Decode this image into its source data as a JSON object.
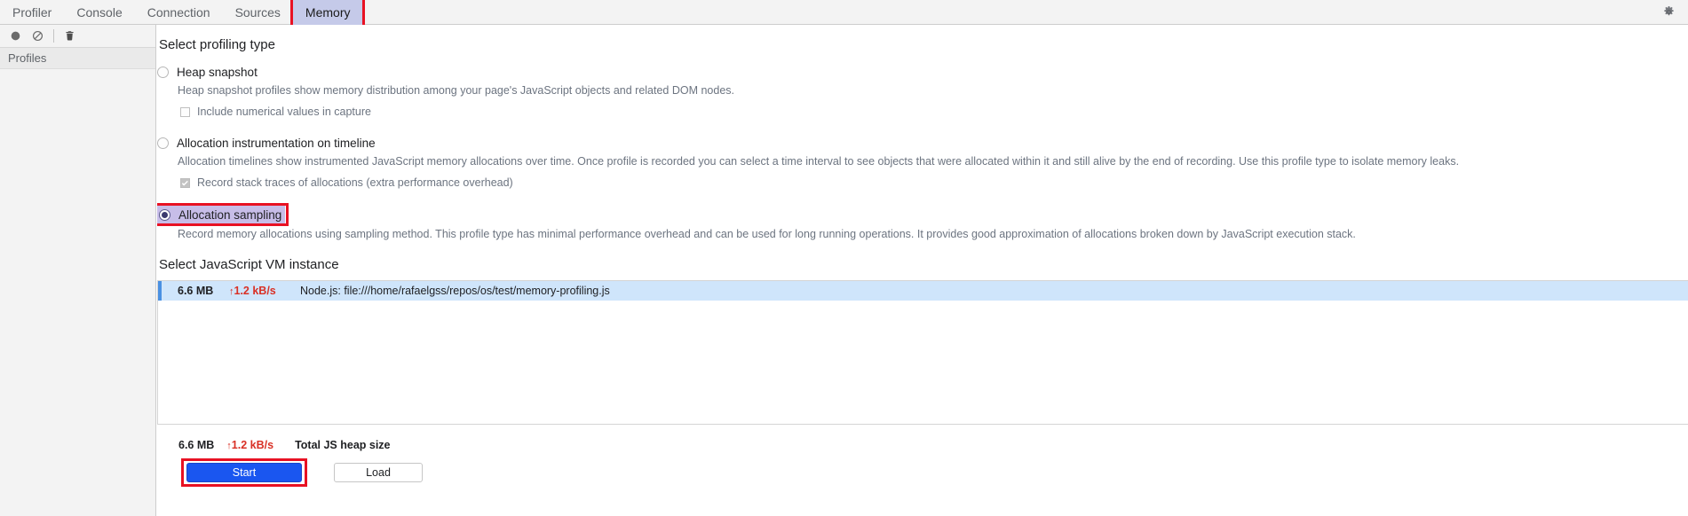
{
  "tabbar": {
    "tabs": [
      {
        "label": "Profiler",
        "selected": false
      },
      {
        "label": "Console",
        "selected": false
      },
      {
        "label": "Connection",
        "selected": false
      },
      {
        "label": "Sources",
        "selected": false
      },
      {
        "label": "Memory",
        "selected": true,
        "annotated": true
      }
    ],
    "settings_icon": "gear-icon"
  },
  "sidebar": {
    "toolbar": [
      {
        "icon": "record-icon",
        "title": "Record"
      },
      {
        "icon": "clear-icon",
        "title": "Clear"
      },
      {
        "icon": "trash-icon",
        "title": "Delete"
      }
    ],
    "profiles_header": "Profiles"
  },
  "main": {
    "profiling_type_title": "Select profiling type",
    "options": [
      {
        "id": "heap-snapshot",
        "label": "Heap snapshot",
        "selected": false,
        "description": "Heap snapshot profiles show memory distribution among your page's JavaScript objects and related DOM nodes.",
        "suboption": {
          "label": "Include numerical values in capture",
          "checked": false
        }
      },
      {
        "id": "allocation-instrumentation-on-timeline",
        "label": "Allocation instrumentation on timeline",
        "selected": false,
        "description": "Allocation timelines show instrumented JavaScript memory allocations over time. Once profile is recorded you can select a time interval to see objects that were allocated within it and still alive by the end of recording. Use this profile type to isolate memory leaks.",
        "suboption": {
          "label": "Record stack traces of allocations (extra performance overhead)",
          "checked": true
        }
      },
      {
        "id": "allocation-sampling",
        "label": "Allocation sampling",
        "selected": true,
        "highlighted": true,
        "annotated": true,
        "description": "Record memory allocations using sampling method. This profile type has minimal performance overhead and can be used for long running operations. It provides good approximation of allocations broken down by JavaScript execution stack."
      }
    ],
    "vm_instance_title": "Select JavaScript VM instance",
    "vm_instances": [
      {
        "size": "6.6 MB",
        "rate": "1.2 kB/s",
        "rate_arrow": "↑",
        "name": "Node.js: file:///home/rafaelgss/repos/os/test/memory-profiling.js",
        "selected": true
      }
    ],
    "footer": {
      "total_size": "6.6 MB",
      "total_rate": "1.2 kB/s",
      "rate_arrow": "↑",
      "total_label": "Total JS heap size",
      "start_button": "Start",
      "load_button": "Load"
    }
  },
  "colors": {
    "accent_blue": "#1a56f0",
    "annotation_red": "#e81123",
    "selected_tab_bg": "#c5cae9",
    "highlight_purple": "#c7bde8",
    "row_selected_bg": "#cfe5fb",
    "rate_red": "#d93025"
  }
}
